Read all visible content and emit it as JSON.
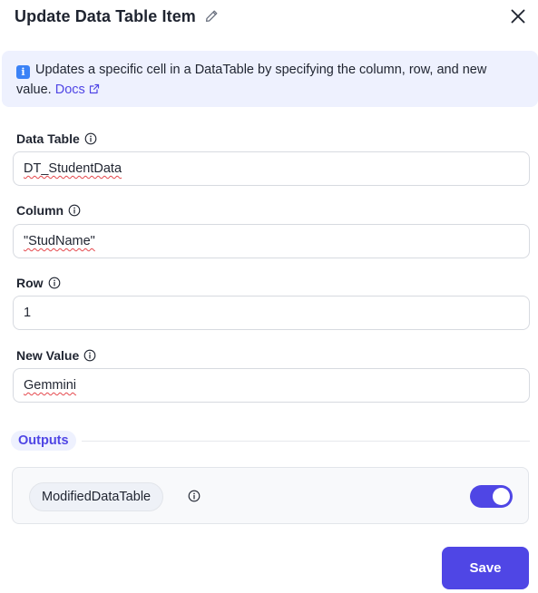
{
  "header": {
    "title": "Update Data Table Item"
  },
  "info": {
    "text": "Updates a specific cell in a DataTable by specifying the column, row, and new value.",
    "docs_label": "Docs",
    "info_glyph": "i"
  },
  "fields": {
    "data_table": {
      "label": "Data Table",
      "value": "DT_StudentData"
    },
    "column": {
      "label": "Column",
      "value": "\"StudName\""
    },
    "row": {
      "label": "Row",
      "value": "1"
    },
    "new_value": {
      "label": "New Value",
      "value": "Gemmini"
    }
  },
  "outputs": {
    "section_label": "Outputs",
    "variable": "ModifiedDataTable",
    "enabled": true
  },
  "footer": {
    "save_label": "Save"
  },
  "colors": {
    "accent": "#4f46e5",
    "banner_bg": "#eef1fe",
    "info_blue": "#3b82f6"
  },
  "icons": [
    "pencil-icon",
    "close-icon",
    "info-square-icon",
    "external-link-icon",
    "info-circle-icon"
  ]
}
